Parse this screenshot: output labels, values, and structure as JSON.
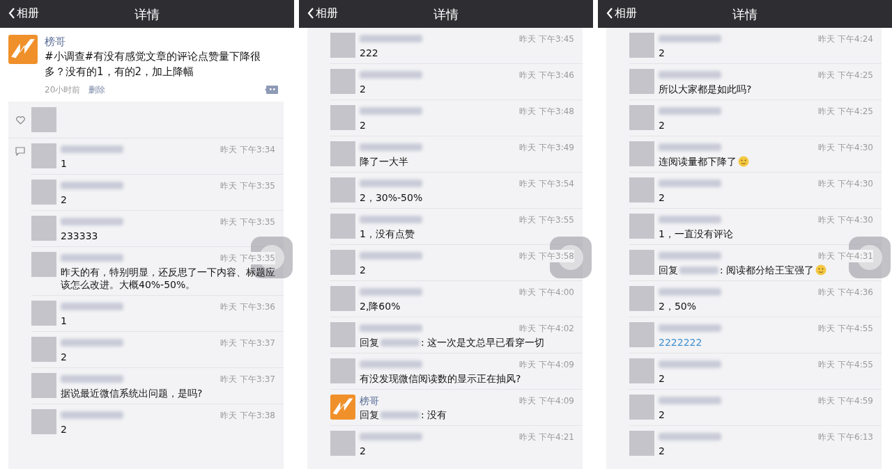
{
  "panels": [
    {
      "header": {
        "back": "相册",
        "title": "详情"
      },
      "overlay_button": true,
      "post": {
        "author": "榜哥",
        "avatar": {
          "kind": "logo"
        },
        "text": "#小调查#有没有感觉文章的评论点赞量下降很多？没有的1，有的2，加上降幅",
        "time": "20小时前",
        "delete": "删除"
      },
      "likes": [
        {
          "avatar": {
            "kind": "photo"
          }
        }
      ],
      "comments_icon": true,
      "comments": [
        {
          "avatar": {
            "kind": "photo"
          },
          "name_hidden": true,
          "time": "昨天 下午3:34",
          "text": "1"
        },
        {
          "avatar": {
            "kind": "photo"
          },
          "name_hidden": true,
          "time": "昨天 下午3:35",
          "text": "2"
        },
        {
          "avatar": {
            "kind": "photo"
          },
          "name_hidden": true,
          "time": "昨天 下午3:35",
          "text": "233333"
        },
        {
          "avatar": {
            "kind": "photo"
          },
          "name_hidden": true,
          "time": "昨天 下午3:35",
          "text": "昨天的有，特别明显，还反思了一下内容、标题应该怎么改进。大概40%-50%。"
        },
        {
          "avatar": {
            "kind": "photo"
          },
          "name_hidden": true,
          "time": "昨天 下午3:36",
          "text": "1"
        },
        {
          "avatar": {
            "kind": "photo"
          },
          "name_hidden": true,
          "time": "昨天 下午3:37",
          "text": "2"
        },
        {
          "avatar": {
            "kind": "photo"
          },
          "name_hidden": true,
          "time": "昨天 下午3:37",
          "text": "据说最近微信系统出问题，是吗?"
        },
        {
          "avatar": {
            "kind": "photo"
          },
          "name_hidden": true,
          "time": "昨天 下午3:38",
          "text": "2"
        }
      ]
    },
    {
      "header": {
        "back": "相册",
        "title": "详情"
      },
      "overlay_button": true,
      "comments": [
        {
          "avatar": {
            "kind": "photo"
          },
          "name_hidden": true,
          "time": "昨天 下午3:45",
          "text": "222"
        },
        {
          "avatar": {
            "kind": "photo"
          },
          "name_hidden": true,
          "time": "昨天 下午3:46",
          "text": "2"
        },
        {
          "avatar": {
            "kind": "photo"
          },
          "name_hidden": true,
          "time": "昨天 下午3:48",
          "text": "2"
        },
        {
          "avatar": {
            "kind": "photo"
          },
          "name_hidden": true,
          "time": "昨天 下午3:49",
          "text": "降了一大半"
        },
        {
          "avatar": {
            "kind": "photo"
          },
          "name_hidden": true,
          "time": "昨天 下午3:54",
          "text": "2，30%-50%"
        },
        {
          "avatar": {
            "kind": "photo"
          },
          "name_hidden": true,
          "time": "昨天 下午3:55",
          "text": "1，没有点赞"
        },
        {
          "avatar": {
            "kind": "photo"
          },
          "name_hidden": true,
          "time": "昨天 下午3:58",
          "text": "2"
        },
        {
          "avatar": {
            "kind": "photo"
          },
          "name_hidden": true,
          "time": "昨天 下午4:00",
          "text": "2,降60%"
        },
        {
          "avatar": {
            "kind": "photo"
          },
          "name_hidden": true,
          "time": "昨天 下午4:02",
          "reply_prefix": "回复",
          "text": ": 这一次是文总早已看穿一切"
        },
        {
          "avatar": {
            "kind": "photo"
          },
          "name_hidden": true,
          "time": "昨天 下午4:09",
          "text": "有没发现微信阅读数的显示正在抽风?"
        },
        {
          "avatar": {
            "kind": "logo"
          },
          "name": "榜哥",
          "name_hidden": false,
          "time": "昨天 下午4:09",
          "reply_prefix": "回复",
          "text": ": 没有"
        },
        {
          "avatar": {
            "kind": "photo"
          },
          "name_hidden": true,
          "time": "昨天 下午4:21",
          "text": "2"
        }
      ]
    },
    {
      "header": {
        "back": "相册",
        "title": "详情"
      },
      "overlay_button": true,
      "comments": [
        {
          "avatar": {
            "kind": "photo"
          },
          "name_hidden": true,
          "time": "昨天 下午4:24",
          "text": "2"
        },
        {
          "avatar": {
            "kind": "photo"
          },
          "name_hidden": true,
          "time": "昨天 下午4:25",
          "text": "所以大家都是如此吗?"
        },
        {
          "avatar": {
            "kind": "photo"
          },
          "name_hidden": true,
          "time": "昨天 下午4:25",
          "text": "2"
        },
        {
          "avatar": {
            "kind": "photo"
          },
          "name_hidden": true,
          "time": "昨天 下午4:30",
          "text": "连阅读量都下降了",
          "emoji": true
        },
        {
          "avatar": {
            "kind": "photo"
          },
          "name_hidden": true,
          "time": "昨天 下午4:30",
          "text": "2"
        },
        {
          "avatar": {
            "kind": "photo"
          },
          "name_hidden": true,
          "time": "昨天 下午4:30",
          "text": "1，一直没有评论"
        },
        {
          "avatar": {
            "kind": "photo"
          },
          "name_hidden": true,
          "time": "昨天 下午4:31",
          "reply_prefix": "回复",
          "text": ": 阅读都分给王宝强了",
          "emoji": true
        },
        {
          "avatar": {
            "kind": "photo"
          },
          "name_hidden": true,
          "time": "昨天 下午4:36",
          "text": "2，50%"
        },
        {
          "avatar": {
            "kind": "photo"
          },
          "name_hidden": true,
          "time": "昨天 下午4:55",
          "text": "2222222",
          "link": true
        },
        {
          "avatar": {
            "kind": "photo"
          },
          "name_hidden": true,
          "time": "昨天 下午4:55",
          "text": "2"
        },
        {
          "avatar": {
            "kind": "photo"
          },
          "name_hidden": true,
          "time": "昨天 下午4:59",
          "text": "2"
        },
        {
          "avatar": {
            "kind": "photo"
          },
          "name_hidden": true,
          "time": "昨天 下午6:13",
          "text": "2"
        }
      ]
    }
  ]
}
